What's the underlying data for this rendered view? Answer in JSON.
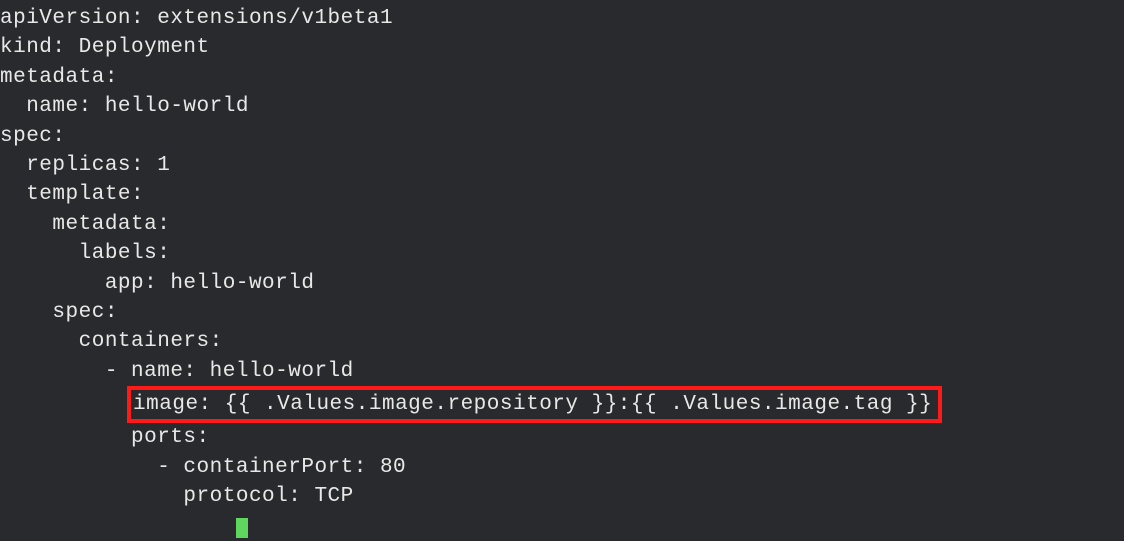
{
  "lines": {
    "l1": "apiVersion: extensions/v1beta1",
    "l2": "kind: Deployment",
    "l3": "metadata:",
    "l4": "  name: hello-world",
    "l5": "spec:",
    "l6": "  replicas: 1",
    "l7": "  template:",
    "l8": "    metadata:",
    "l9": "      labels:",
    "l10": "        app: hello-world",
    "l11": "    spec:",
    "l12": "      containers:",
    "l13": "        - name: hello-world",
    "l14_prefix": "          ",
    "l14_highlighted": "image: {{ .Values.image.repository }}:{{ .Values.image.tag }}",
    "l15": "          ports:",
    "l16": "            - containerPort: 80",
    "l17": "              protocol: TCP"
  }
}
